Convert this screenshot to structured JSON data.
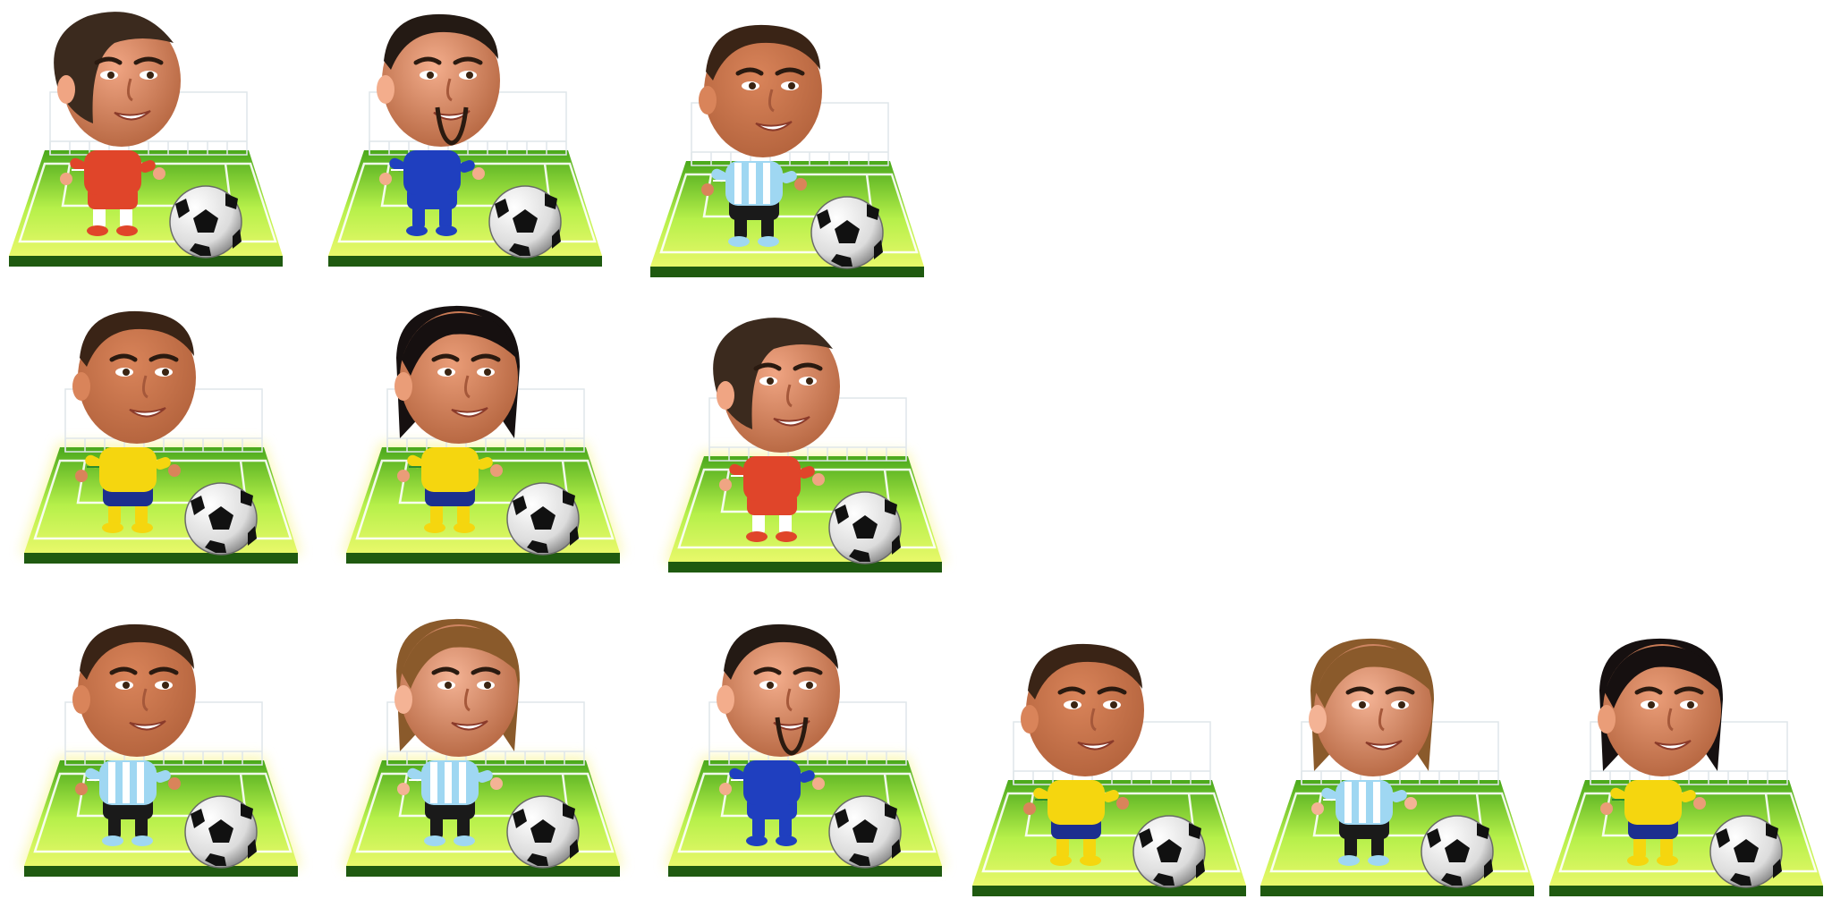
{
  "sheet": {
    "background": "#ffffff",
    "grass_light": "#b6f04a",
    "grass_dark": "#4aa81c",
    "pitch_base": "#1f5a10"
  },
  "players": [
    {
      "id": "red-curly-hair",
      "hair": "#3b2a1e",
      "hair_style": "curly",
      "skin": "#f0a583",
      "shirt": "#e0452a",
      "shorts": "#e0452a",
      "sleeve_stripe": "#ffffff",
      "socks": "#ffffff",
      "glow": false
    },
    {
      "id": "blue-goatee",
      "hair": "#241a14",
      "hair_style": "short",
      "skin": "#f3ad8c",
      "shirt": "#1f3fbf",
      "shorts": "#1f3fbf",
      "sleeve_stripe": "#ffffff",
      "socks": "#1f3fbf",
      "glow": false
    },
    {
      "id": "argentina-smile",
      "hair": "#3a2416",
      "hair_style": "short",
      "skin": "#d9845a",
      "shirt": "#9fd7f2",
      "shorts": "#1a1a1a",
      "sleeve_stripe": "#ffffff",
      "socks": "#1a1a1a",
      "glow": false
    },
    {
      "id": "yellow-bald",
      "hair": "#3a2416",
      "hair_style": "short",
      "skin": "#d9845a",
      "shirt": "#f5d60f",
      "shorts": "#1c2f8f",
      "sleeve_stripe": "#2c8c2c",
      "socks": "#f5d60f",
      "glow": true
    },
    {
      "id": "yellow-long-hair",
      "hair": "#161010",
      "hair_style": "long",
      "skin": "#ea9d78",
      "shirt": "#f5d60f",
      "shorts": "#1c2f8f",
      "sleeve_stripe": "#2c8c2c",
      "socks": "#f5d60f",
      "glow": true
    },
    {
      "id": "red-curly-hair-glow",
      "hair": "#3b2a1e",
      "hair_style": "curly",
      "skin": "#f0a583",
      "shirt": "#e0452a",
      "shorts": "#e0452a",
      "sleeve_stripe": "#ffffff",
      "socks": "#ffffff",
      "glow": true
    },
    {
      "id": "argentina-smile-glow",
      "hair": "#3a2416",
      "hair_style": "short",
      "skin": "#d9845a",
      "shirt": "#9fd7f2",
      "shorts": "#1a1a1a",
      "sleeve_stripe": "#ffffff",
      "socks": "#1a1a1a",
      "glow": true
    },
    {
      "id": "argentina-brown-hair",
      "hair": "#8a5a2b",
      "hair_style": "long",
      "skin": "#f4b395",
      "shirt": "#9fd7f2",
      "shorts": "#1a1a1a",
      "sleeve_stripe": "#ffffff",
      "socks": "#1a1a1a",
      "glow": true
    },
    {
      "id": "blue-goatee-glow",
      "hair": "#241a14",
      "hair_style": "short",
      "skin": "#f3ad8c",
      "shirt": "#1f3fbf",
      "shorts": "#1f3fbf",
      "sleeve_stripe": "#ffffff",
      "socks": "#1f3fbf",
      "glow": true
    },
    {
      "id": "yellow-bald-plain",
      "hair": "#3a2416",
      "hair_style": "short",
      "skin": "#d9845a",
      "shirt": "#f5d60f",
      "shorts": "#1c2f8f",
      "sleeve_stripe": "#2c8c2c",
      "socks": "#f5d60f",
      "glow": false
    },
    {
      "id": "argentina-brown-hair-plain",
      "hair": "#8a5a2b",
      "hair_style": "long",
      "skin": "#f4b395",
      "shirt": "#9fd7f2",
      "shorts": "#1a1a1a",
      "sleeve_stripe": "#ffffff",
      "socks": "#1a1a1a",
      "glow": false
    },
    {
      "id": "yellow-long-hair-plain",
      "hair": "#161010",
      "hair_style": "long",
      "skin": "#ea9d78",
      "shirt": "#f5d60f",
      "shorts": "#1c2f8f",
      "sleeve_stripe": "#2c8c2c",
      "socks": "#f5d60f",
      "glow": false
    }
  ]
}
